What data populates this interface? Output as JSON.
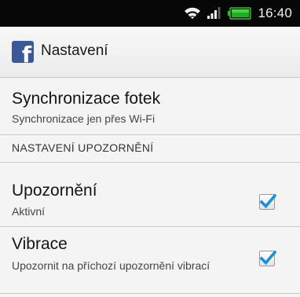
{
  "status_bar": {
    "time": "16:40",
    "icons": [
      "wifi-icon",
      "signal-icon",
      "battery-icon"
    ]
  },
  "app_bar": {
    "logo_icon": "facebook-logo-icon",
    "title": "Nastavení"
  },
  "settings": {
    "sync": {
      "title": "Synchronizace fotek",
      "subtitle": "Synchronizace jen přes Wi-Fi"
    },
    "section_header": "NASTAVENÍ UPOZORNĚNÍ",
    "notifications": {
      "title": "Upozornění",
      "subtitle": "Aktivní",
      "checked": true
    },
    "vibration": {
      "title": "Vibrace",
      "subtitle": "Upozornit na příchozí upozornění vibrací",
      "checked": true
    }
  },
  "colors": {
    "status_bar_bg": "#070707",
    "facebook_blue": "#3b5998",
    "checkmark_blue": "#1b8fd8",
    "list_bg": "#f4f4f4"
  }
}
